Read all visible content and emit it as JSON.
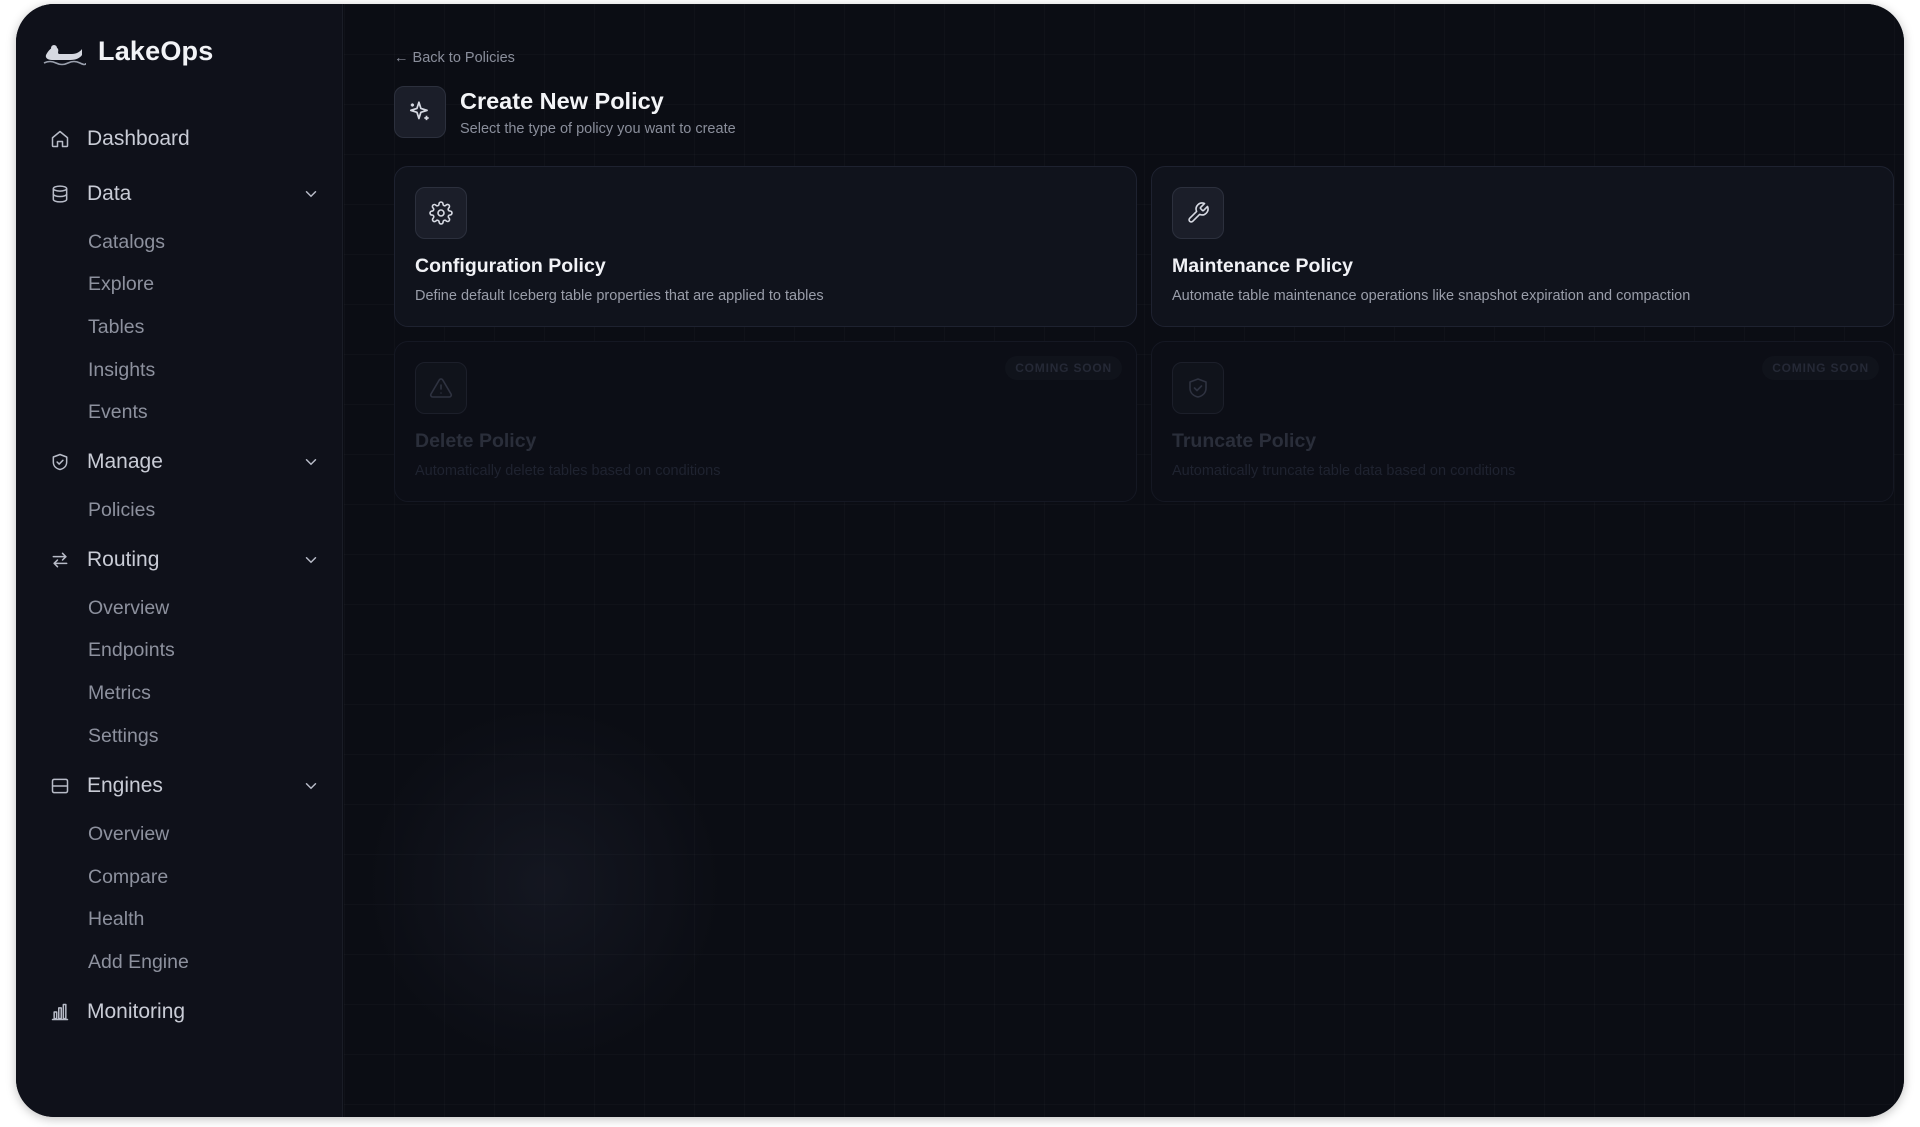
{
  "app": {
    "name": "LakeOps"
  },
  "sidebar": {
    "dashboard": "Dashboard",
    "data": {
      "label": "Data",
      "items": [
        "Catalogs",
        "Explore",
        "Tables",
        "Insights",
        "Events"
      ]
    },
    "manage": {
      "label": "Manage",
      "items": [
        "Policies"
      ]
    },
    "routing": {
      "label": "Routing",
      "items": [
        "Overview",
        "Endpoints",
        "Metrics",
        "Settings"
      ]
    },
    "engines": {
      "label": "Engines",
      "items": [
        "Overview",
        "Compare",
        "Health",
        "Add Engine"
      ]
    },
    "monitoring": "Monitoring"
  },
  "header": {
    "back": "← Back to Policies",
    "title": "Create New Policy",
    "subtitle": "Select the type of policy you want to create"
  },
  "cards": [
    {
      "title": "Configuration Policy",
      "description": "Define default Iceberg table properties that are applied to tables",
      "icon": "gear-icon",
      "enabled": true
    },
    {
      "title": "Maintenance Policy",
      "description": "Automate table maintenance operations like snapshot expiration and compaction",
      "icon": "wrench-icon",
      "enabled": true
    },
    {
      "title": "Delete Policy",
      "description": "Automatically delete tables based on conditions",
      "icon": "warning-triangle-icon",
      "badge": "COMING SOON",
      "enabled": false
    },
    {
      "title": "Truncate Policy",
      "description": "Automatically truncate table data based on conditions",
      "icon": "shield-check-icon",
      "badge": "COMING SOON",
      "enabled": false
    }
  ],
  "colors": {
    "background": "#0b0d14",
    "sidebar": "#0f111a",
    "card": "#10131c",
    "text": "#f1f2f6",
    "muted": "#8a8e9b"
  }
}
